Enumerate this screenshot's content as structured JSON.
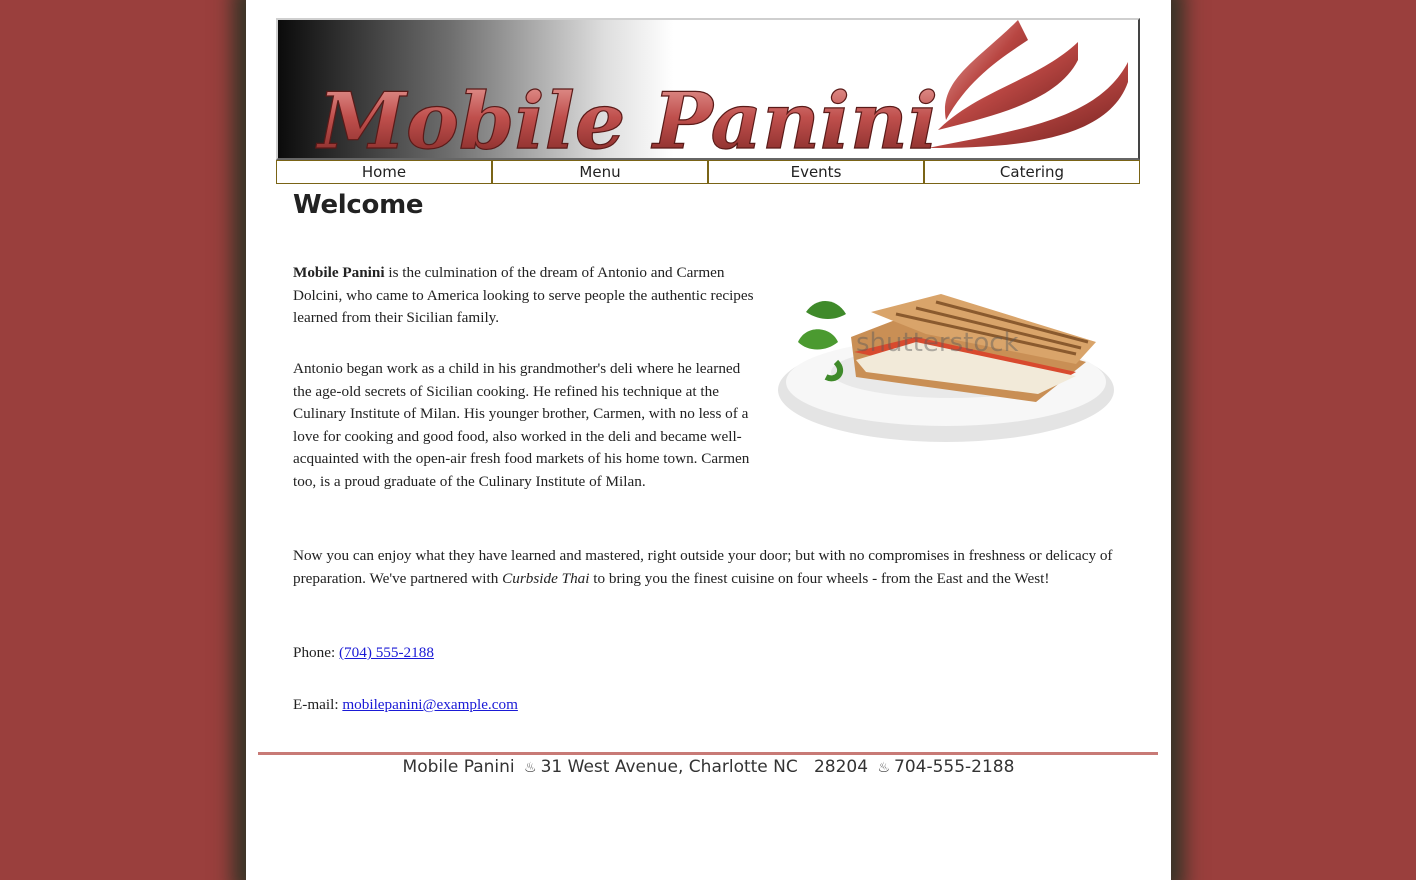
{
  "header": {
    "logo_text": "Mobile Panini"
  },
  "nav": {
    "items": [
      {
        "label": "Home"
      },
      {
        "label": "Menu"
      },
      {
        "label": "Events"
      },
      {
        "label": "Catering"
      }
    ]
  },
  "main": {
    "title": "Welcome",
    "image_watermark": "shutterstock",
    "paragraph1": {
      "brand": "Mobile Panini",
      "text": " is the culmination of the dream of Antonio and Carmen Dolcini, who came to America looking to serve people the authentic recipes learned from their Sicilian family."
    },
    "paragraph2": "Antonio began work as a child in his grandmother's deli where he learned the age-old secrets of Sicilian cooking. He refined his technique at the Culinary Institute of Milan. His younger brother, Carmen, with no less of a love for cooking and good food, also worked in the deli and became well-acquainted with the open-air fresh food markets of his home town. Carmen too, is a proud graduate of the Culinary Institute of Milan.",
    "paragraph3": {
      "before": "Now you can enjoy what they have learned and mastered, right outside your door; but with no compromises in freshness or delicacy of preparation. We've partnered with ",
      "partner": "Curbside Thai",
      "after": " to bring you the finest cuisine on four wheels - from the East and the West!"
    },
    "phone": {
      "label": "Phone: ",
      "value": "(704) 555-2188"
    },
    "email": {
      "label": "E-mail: ",
      "value": "mobilepanini@example.com"
    }
  },
  "footer": {
    "name": "Mobile Panini",
    "separator": "♨",
    "address": "31 West Avenue, Charlotte NC   28204",
    "phone": "704-555-2188"
  },
  "colors": {
    "background": "#9a3f3d",
    "logo_red": "#c0504d",
    "nav_border": "#7a6416",
    "footer_rule": "#c87a76",
    "link": "#1a1ad6"
  }
}
